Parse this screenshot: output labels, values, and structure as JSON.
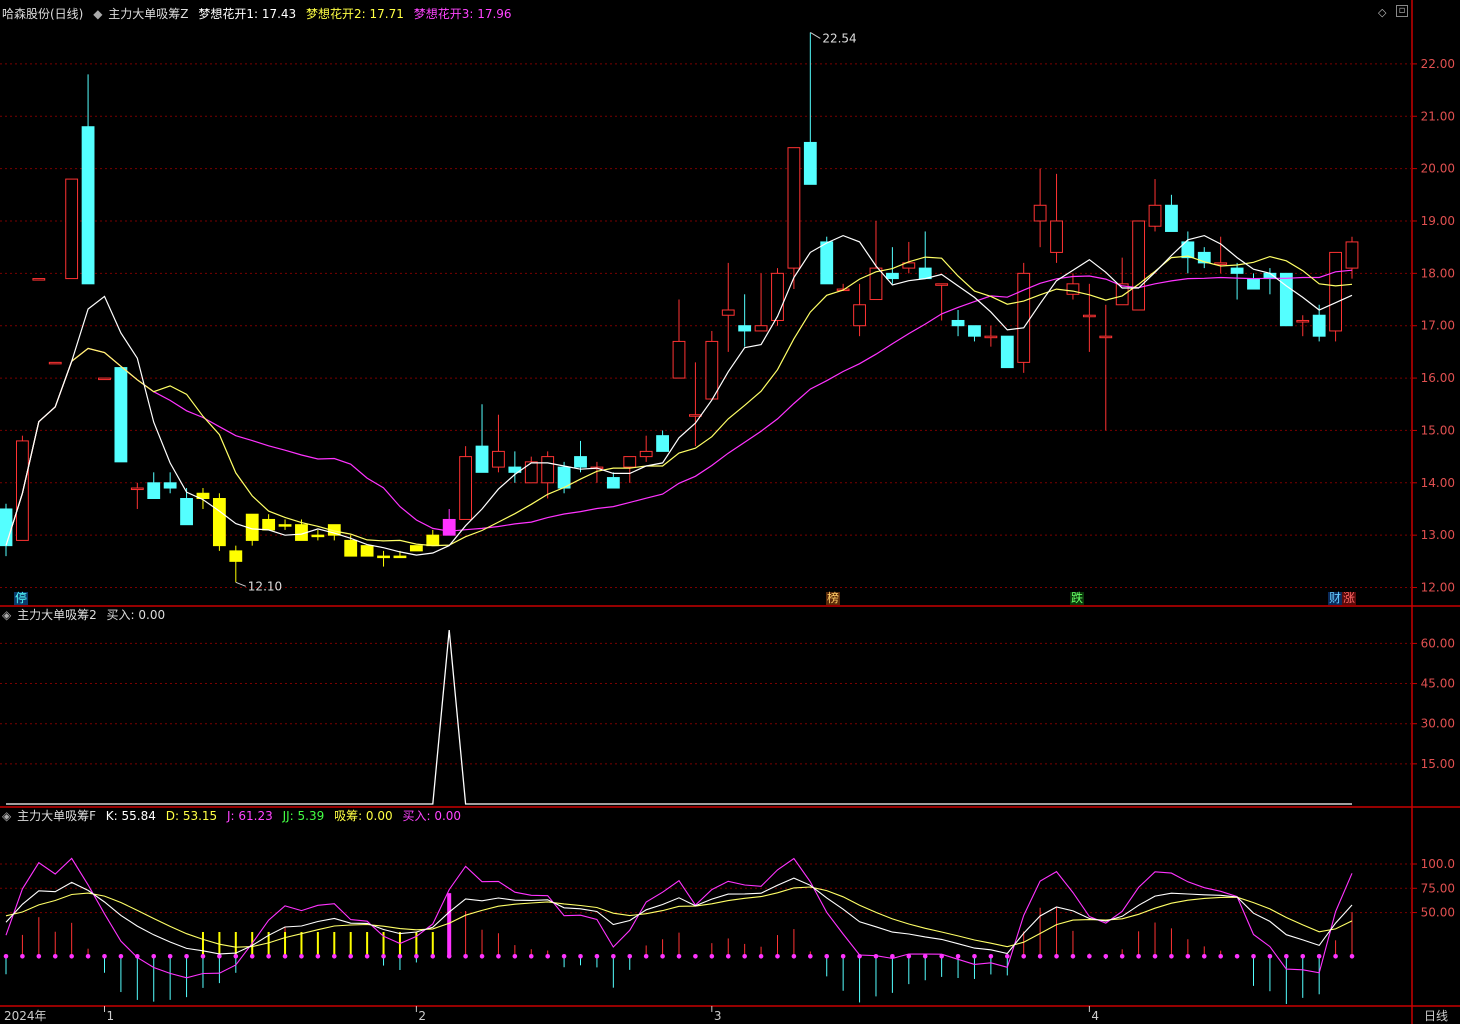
{
  "colors": {
    "up": "#ff3333",
    "down": "#54ffff",
    "absorb": "#ffff00",
    "buy": "#ff33ff",
    "ma1": "#ffffff",
    "ma2": "#ffff66",
    "ma3": "#ff33ff",
    "grid": "#7a0000",
    "axis": "#c80000",
    "axis_text": "#e05050"
  },
  "main_panel": {
    "title": "哈森股份(日线)",
    "indicator": "主力大单吸筹Z",
    "lines": [
      {
        "label": "梦想花开1: 17.43",
        "color": "#ffffff"
      },
      {
        "label": "梦想花开2: 17.71",
        "color": "#ffff44"
      },
      {
        "label": "梦想花开3: 17.96",
        "color": "#ff44ff"
      }
    ],
    "y_ticks": [
      "22.00",
      "21.00",
      "20.00",
      "19.00",
      "18.00",
      "17.00",
      "16.00",
      "15.00",
      "14.00",
      "13.00",
      "12.00"
    ],
    "high_label": "22.54",
    "low_label": "12.10",
    "flags": [
      {
        "text": "停",
        "fg": "#54ffff",
        "bg": "#0a3a6a"
      },
      {
        "text": "榜",
        "fg": "#ffcc66",
        "bg": "#5a2a0a"
      },
      {
        "text": "跌",
        "fg": "#66ff66",
        "bg": "#0a3a0a"
      },
      {
        "text": "财",
        "fg": "#66ccff",
        "bg": "#0a2a5a"
      },
      {
        "text": "涨",
        "fg": "#ff6666",
        "bg": "#5a0a0a"
      }
    ]
  },
  "panel2": {
    "indicator": "主力大单吸筹2",
    "label": "买入: 0.00",
    "y_ticks": [
      "60.00",
      "45.00",
      "30.00",
      "15.00"
    ],
    "chart_data": {
      "type": "line",
      "peak": 65,
      "baseline": 0,
      "peak_bar": 27
    }
  },
  "panel3": {
    "indicator": "主力大单吸筹F",
    "k": "K: 55.84",
    "d": "D: 53.15",
    "j": "J: 61.23",
    "jj": "JJ: 5.39",
    "xichou": "吸筹: 0.00",
    "mairu": "买入: 0.00",
    "y_ticks": [
      "100.0",
      "75.00",
      "50.00"
    ]
  },
  "x_axis": {
    "labels": [
      "2024年",
      "1",
      "2",
      "3",
      "4"
    ],
    "period": "日线"
  },
  "chart_data": {
    "type": "candlestick",
    "ylim": [
      11.8,
      22.8
    ],
    "candles": [
      [
        13.5,
        13.6,
        12.6,
        12.8
      ],
      [
        12.9,
        14.9,
        12.9,
        14.8
      ],
      [
        17.9,
        17.9,
        17.9,
        17.9
      ],
      [
        16.3,
        16.3,
        16.3,
        16.3
      ],
      [
        17.9,
        19.8,
        17.9,
        19.8
      ],
      [
        20.8,
        21.8,
        17.8,
        17.8
      ],
      [
        16.0,
        16.0,
        16.0,
        16.0
      ],
      [
        16.2,
        16.2,
        14.4,
        14.4
      ],
      [
        13.9,
        14.0,
        13.5,
        13.9
      ],
      [
        14.0,
        14.2,
        13.8,
        13.7
      ],
      [
        14.0,
        14.2,
        13.8,
        13.9
      ],
      [
        13.7,
        13.9,
        13.2,
        13.2
      ],
      [
        13.8,
        13.9,
        13.5,
        13.7
      ],
      [
        13.7,
        13.8,
        12.7,
        12.8
      ],
      [
        12.7,
        12.8,
        12.1,
        12.5
      ],
      [
        12.9,
        13.4,
        12.8,
        13.4
      ],
      [
        13.3,
        13.4,
        13.1,
        13.1
      ],
      [
        13.2,
        13.3,
        13.1,
        13.2
      ],
      [
        13.2,
        13.3,
        12.9,
        12.9
      ],
      [
        13.0,
        13.1,
        12.9,
        13.0
      ],
      [
        13.2,
        13.2,
        12.9,
        13.0
      ],
      [
        12.9,
        13.0,
        12.6,
        12.6
      ],
      [
        12.8,
        12.8,
        12.6,
        12.6
      ],
      [
        12.6,
        12.7,
        12.4,
        12.6
      ],
      [
        12.6,
        12.7,
        12.6,
        12.6
      ],
      [
        12.8,
        12.8,
        12.7,
        12.7
      ],
      [
        13.0,
        13.1,
        12.9,
        12.8
      ],
      [
        13.0,
        13.5,
        13.0,
        13.3
      ],
      [
        13.3,
        14.7,
        13.3,
        14.5
      ],
      [
        14.7,
        15.5,
        14.2,
        14.2
      ],
      [
        14.3,
        15.3,
        14.2,
        14.6
      ],
      [
        14.3,
        14.6,
        14.0,
        14.2
      ],
      [
        14.0,
        14.5,
        14.0,
        14.4
      ],
      [
        14.0,
        14.6,
        13.7,
        14.5
      ],
      [
        14.3,
        14.4,
        13.8,
        13.9
      ],
      [
        14.5,
        14.8,
        14.2,
        14.3
      ],
      [
        14.3,
        14.4,
        14.0,
        14.3
      ],
      [
        14.1,
        14.2,
        13.9,
        13.9
      ],
      [
        14.3,
        14.5,
        14.0,
        14.5
      ],
      [
        14.5,
        14.9,
        14.4,
        14.6
      ],
      [
        14.9,
        15.0,
        14.6,
        14.6
      ],
      [
        16.0,
        17.5,
        16.0,
        16.7
      ],
      [
        15.3,
        16.3,
        14.7,
        15.3
      ],
      [
        15.6,
        16.9,
        15.6,
        16.7
      ],
      [
        17.2,
        18.2,
        16.5,
        17.3
      ],
      [
        17.0,
        17.6,
        16.6,
        16.9
      ],
      [
        16.9,
        18.0,
        16.9,
        17.0
      ],
      [
        17.1,
        18.1,
        17.0,
        18.0
      ],
      [
        18.1,
        20.4,
        17.7,
        20.4
      ],
      [
        20.5,
        22.6,
        19.7,
        19.7
      ],
      [
        18.6,
        18.7,
        17.8,
        17.8
      ],
      [
        17.7,
        17.8,
        17.7,
        17.7
      ],
      [
        17.0,
        17.8,
        16.8,
        17.4
      ],
      [
        17.5,
        19.0,
        17.5,
        18.1
      ],
      [
        18.0,
        18.5,
        17.8,
        17.9
      ],
      [
        18.1,
        18.6,
        18.0,
        18.2
      ],
      [
        18.1,
        18.8,
        18.0,
        17.9
      ],
      [
        17.8,
        17.8,
        17.1,
        17.8
      ],
      [
        17.1,
        17.3,
        16.8,
        17.0
      ],
      [
        17.0,
        17.0,
        16.7,
        16.8
      ],
      [
        16.8,
        17.0,
        16.6,
        16.8
      ],
      [
        16.8,
        16.8,
        16.2,
        16.2
      ],
      [
        16.3,
        18.2,
        16.1,
        18.0
      ],
      [
        19.0,
        20.0,
        18.5,
        19.3
      ],
      [
        18.4,
        19.9,
        18.2,
        19.0
      ],
      [
        17.6,
        18.0,
        17.5,
        17.8
      ],
      [
        17.2,
        17.8,
        16.5,
        17.2
      ],
      [
        16.8,
        17.4,
        15.0,
        16.8
      ],
      [
        17.4,
        18.3,
        17.4,
        17.8
      ],
      [
        17.3,
        19.0,
        17.3,
        19.0
      ],
      [
        18.9,
        19.8,
        18.8,
        19.3
      ],
      [
        19.3,
        19.5,
        18.8,
        18.8
      ],
      [
        18.6,
        18.8,
        18.0,
        18.3
      ],
      [
        18.4,
        18.5,
        18.1,
        18.2
      ],
      [
        18.2,
        18.7,
        18.0,
        18.2
      ],
      [
        18.1,
        18.2,
        17.5,
        18.0
      ],
      [
        17.9,
        18.0,
        17.7,
        17.7
      ],
      [
        18.0,
        18.1,
        17.6,
        17.9
      ],
      [
        18.0,
        18.0,
        17.0,
        17.0
      ],
      [
        17.1,
        17.2,
        16.8,
        17.1
      ],
      [
        17.2,
        17.4,
        16.7,
        16.8
      ],
      [
        16.9,
        18.4,
        16.7,
        18.4
      ],
      [
        18.1,
        18.7,
        17.9,
        18.6
      ]
    ],
    "highlight": {
      "absorb_from": 12,
      "absorb_to": 26,
      "buy": 27
    },
    "ma": {
      "ma1": [],
      "ma2": [],
      "ma3": []
    }
  }
}
